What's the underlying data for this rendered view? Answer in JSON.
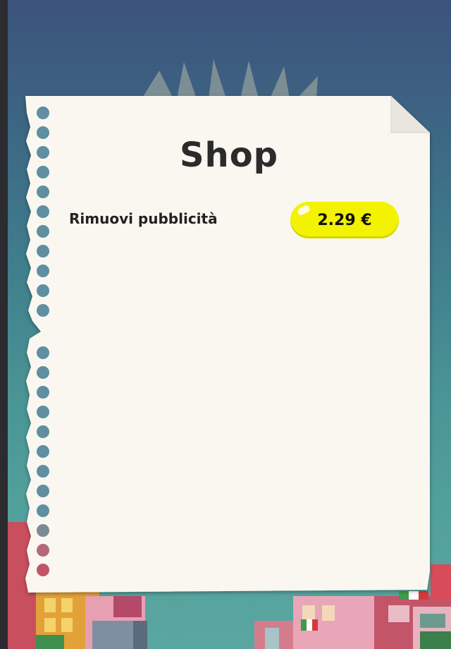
{
  "shop": {
    "title": "Shop",
    "items": [
      {
        "label": "Rimuovi pubblicità",
        "price": "2.29 €"
      }
    ]
  },
  "colors": {
    "sky_top": "#3c537b",
    "sky_bottom": "#5aa6a0",
    "paper": "#f9f7f0",
    "price_button": "#f3f200",
    "title_text": "#2b2b2b"
  }
}
